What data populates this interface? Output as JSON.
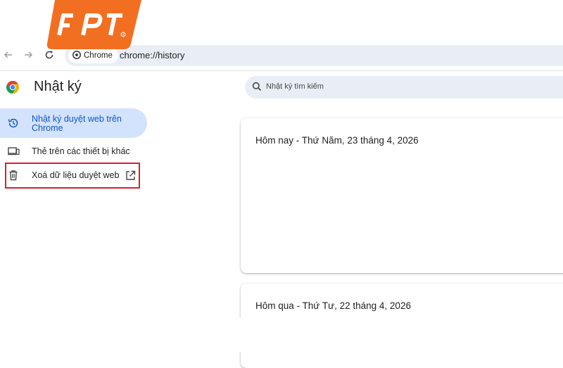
{
  "brand": {
    "logo_text": "FPT",
    "logo_color": "#f26f21"
  },
  "browser": {
    "chip_label": "Chrome",
    "url": "chrome://history"
  },
  "page": {
    "title": "Nhật ký"
  },
  "sidebar": {
    "items": [
      {
        "label": "Nhật ký duyệt web trên Chrome",
        "icon": "history-icon",
        "active": true
      },
      {
        "label": "Thẻ trên các thiết bị khác",
        "icon": "devices-icon",
        "active": false
      },
      {
        "label": "Xoá dữ liệu duyệt web",
        "icon": "trash-icon",
        "trailing_icon": "open-external-icon",
        "active": false
      }
    ]
  },
  "search": {
    "placeholder": "Nhật ký tìm kiếm"
  },
  "history": {
    "groups": [
      {
        "heading": "Hôm nay - Thứ Năm, 23 tháng 4, 2026"
      },
      {
        "heading": "Hôm qua - Thứ Tư, 22 tháng 4, 2026"
      }
    ]
  },
  "colors": {
    "active_bg": "#d3e3fd",
    "active_text": "#0b57d0",
    "omnibox_bg": "#e9eef6",
    "highlight_border": "#d9202a"
  }
}
